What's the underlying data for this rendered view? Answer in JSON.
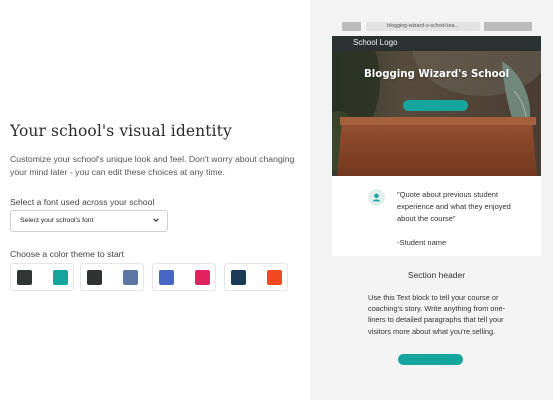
{
  "setup": {
    "title": "Your school's visual identity",
    "description": "Customize your school's unique look and feel. Don't worry about changing your mind later - you can edit these choices at any time.",
    "font_label": "Select a font used across your school",
    "font_select_value": "Select your school's font",
    "color_label": "Choose a color theme to start",
    "themes": [
      {
        "colors": [
          "#2f3533",
          "#ffffff",
          "#16a59e"
        ]
      },
      {
        "colors": [
          "#2f3231",
          "#ffffff",
          "#5d76a3"
        ]
      },
      {
        "colors": [
          "#4667c4",
          "#ffffff",
          "#e0235f"
        ]
      },
      {
        "colors": [
          "#1a3a58",
          "#ffffff",
          "#f0491f"
        ]
      }
    ]
  },
  "preview": {
    "browser_url": "blogging-wizard-s-school.tea...",
    "logo": "School Logo",
    "hero_title": "Blogging Wizard's School",
    "quote": "\"Quote about previous student experience and what they enjoyed about the course\"",
    "quote_author": "-Student name",
    "section_header": "Section header",
    "section_text": "Use this Text block to tell your course or coaching's story. Write anything from one-liners to detailed paragraphs that tell your visitors more about what you're selling.",
    "accent_color": "#16a59e"
  }
}
